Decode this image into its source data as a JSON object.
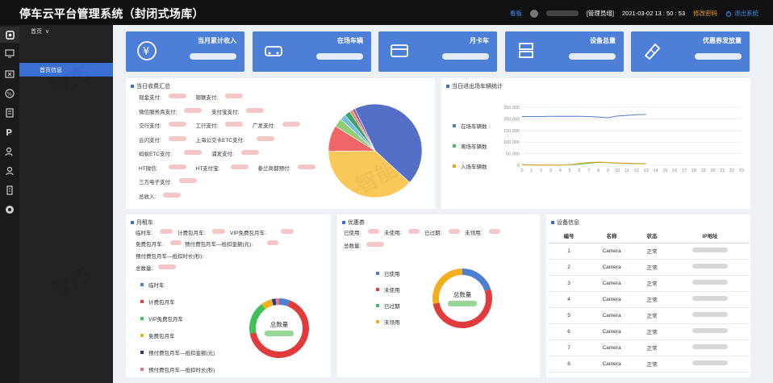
{
  "app": {
    "title": "停车云平台管理系统（封闭式场库）"
  },
  "topbar": {
    "board": "看板",
    "user_role": "[管理员组]",
    "datetime": "2021-03-02 13 : 50 : 53",
    "change_pwd": "修改密码",
    "logout": "退出系统"
  },
  "sidebar": {
    "group": "首页",
    "active_item": "首页信息"
  },
  "kpis": [
    {
      "label": "当月累计收入",
      "icon": "yen-icon"
    },
    {
      "label": "在场车辆",
      "icon": "car-icon"
    },
    {
      "label": "月卡车",
      "icon": "card-icon"
    },
    {
      "label": "设备总量",
      "icon": "device-icon"
    },
    {
      "label": "优惠券发放量",
      "icon": "coupon-icon"
    }
  ],
  "income": {
    "title": "当日收费汇总",
    "rows": [
      [
        "现金支付:",
        "银联支付:"
      ],
      [
        "微信服务商支付:",
        "支付宝支付:"
      ],
      [
        "交行支付:",
        "工行支付:",
        "广发支付:"
      ],
      [
        "云闪支付:",
        "上海公交卡ETC支付:"
      ],
      [
        "蚂蚁ETC支付:",
        "浦发支付:"
      ],
      [
        "HT微信:",
        "HT支付宝:",
        "泰兰商都预付:"
      ],
      [
        "三方电子支付:"
      ],
      [
        "总收入:"
      ]
    ],
    "pie_colors": [
      "#5470c6",
      "#fac858",
      "#ee6666",
      "#91cc75",
      "#73c0de",
      "#3ba272",
      "#fc8452",
      "#9a60b4"
    ]
  },
  "traffic": {
    "title": "当日进出场车辆统计",
    "legend": [
      "在场车辆数",
      "离场车辆数",
      "入场车辆数"
    ],
    "colors": [
      "#4f7fcf",
      "#40c057",
      "#f0a020"
    ],
    "chart_data": {
      "type": "line",
      "x": [
        "0",
        "1",
        "2",
        "3",
        "4",
        "5",
        "6",
        "7",
        "8",
        "9",
        "10",
        "11",
        "12",
        "13",
        "14",
        "15",
        "16",
        "17",
        "18",
        "19",
        "20",
        "21",
        "22",
        "23"
      ],
      "ylim": [
        0,
        250000
      ],
      "yticks": [
        "250,000",
        "200,000",
        "150,000",
        "100,000",
        "50,000",
        "0"
      ],
      "series": [
        {
          "name": "在场车辆数",
          "values": [
            210000,
            210000,
            210000,
            211000,
            211000,
            211000,
            211000,
            210000,
            208000,
            205000,
            212000,
            215000,
            218000,
            219000,
            null,
            null,
            null,
            null,
            null,
            null,
            null,
            null,
            null,
            null
          ]
        },
        {
          "name": "离场车辆数",
          "values": [
            3000,
            2000,
            1000,
            1000,
            1000,
            2000,
            5000,
            9000,
            12000,
            11000,
            9000,
            8000,
            7000,
            6000,
            null,
            null,
            null,
            null,
            null,
            null,
            null,
            null,
            null,
            null
          ]
        },
        {
          "name": "入场车辆数",
          "values": [
            2000,
            1500,
            1000,
            800,
            1000,
            3000,
            8000,
            12000,
            14000,
            12000,
            10000,
            9000,
            8000,
            7000,
            null,
            null,
            null,
            null,
            null,
            null,
            null,
            null,
            null,
            null
          ]
        }
      ]
    }
  },
  "monthly": {
    "title": "月租车",
    "line1": [
      "临时车:",
      "计费包月车:",
      "VIP免费包月车:"
    ],
    "line2": [
      "免费包月车:",
      "预付费包月车—抵扣金额(元):"
    ],
    "line3": "预付费包月车—抵扣时长(秒):",
    "total": "总数量:",
    "legend": [
      "临时车",
      "计费包月车",
      "VIP免费包月车",
      "免费包月车",
      "预付费包月车—抵扣金额(元)",
      "预付费包月车—抵扣时长(秒)"
    ],
    "colors": [
      "#4f7fcf",
      "#e23b3b",
      "#40c057",
      "#f0b020",
      "#1f3a8a",
      "#e87878"
    ],
    "donut_label": "总数量"
  },
  "coupon": {
    "title": "优惠券",
    "line1": [
      "已使用:",
      "未使用:",
      "已过期:",
      "未领用:"
    ],
    "total": "总数量:",
    "legend": [
      "已使用",
      "未使用",
      "已过期",
      "未领用"
    ],
    "colors": [
      "#4f7fcf",
      "#e23b3b",
      "#40c057",
      "#f0b020"
    ],
    "donut_label": "总数量"
  },
  "devices": {
    "title": "设备信息",
    "headers": [
      "编号",
      "名称",
      "状态",
      "IP地址"
    ],
    "rows": [
      [
        "1",
        "Camera",
        "正常"
      ],
      [
        "2",
        "Camera",
        "正常"
      ],
      [
        "3",
        "Camera",
        "正常"
      ],
      [
        "4",
        "Camera",
        "正常"
      ],
      [
        "5",
        "Camera",
        "正常"
      ],
      [
        "6",
        "Camera",
        "正常"
      ],
      [
        "7",
        "Camera",
        "正常"
      ],
      [
        "8",
        "Camera",
        "正常"
      ]
    ]
  }
}
